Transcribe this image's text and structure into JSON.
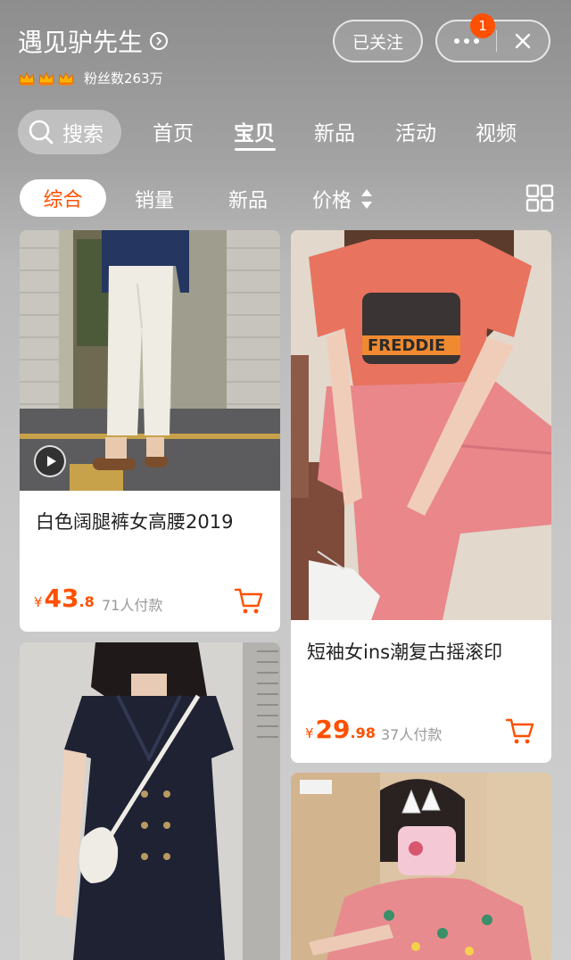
{
  "header": {
    "shop_name": "遇见驴先生",
    "fans_text": "粉丝数263万",
    "follow_label": "已关注",
    "notification_count": "1"
  },
  "nav": {
    "search_label": "搜索",
    "tabs": [
      {
        "label": "首页"
      },
      {
        "label": "宝贝"
      },
      {
        "label": "新品"
      },
      {
        "label": "活动"
      },
      {
        "label": "视频"
      }
    ],
    "active_tab": "宝贝"
  },
  "sort": {
    "items": [
      {
        "label": "综合"
      },
      {
        "label": "销量"
      },
      {
        "label": "新品"
      },
      {
        "label": "价格"
      }
    ],
    "active": "综合"
  },
  "products": [
    {
      "title": "白色阔腿裤女高腰2019",
      "currency": "¥",
      "price_int": "43",
      "price_dec": ".8",
      "sales": "71人付款",
      "has_video": true
    },
    {
      "title": "短袖女ins潮复古摇滚印",
      "currency": "¥",
      "price_int": "29",
      "price_dec": ".98",
      "sales": "37人付款",
      "has_video": false
    },
    {
      "title": "",
      "has_video": false
    },
    {
      "title": "",
      "has_video": false
    }
  ],
  "colors": {
    "accent": "#ff5000",
    "card_bg": "#ffffff",
    "muted_text": "#999999"
  },
  "icons": [
    "chevron-right-icon",
    "crown-icon",
    "more-dots-icon",
    "close-icon",
    "search-icon",
    "sort-arrows-icon",
    "grid-toggle-icon",
    "play-icon",
    "cart-icon"
  ]
}
